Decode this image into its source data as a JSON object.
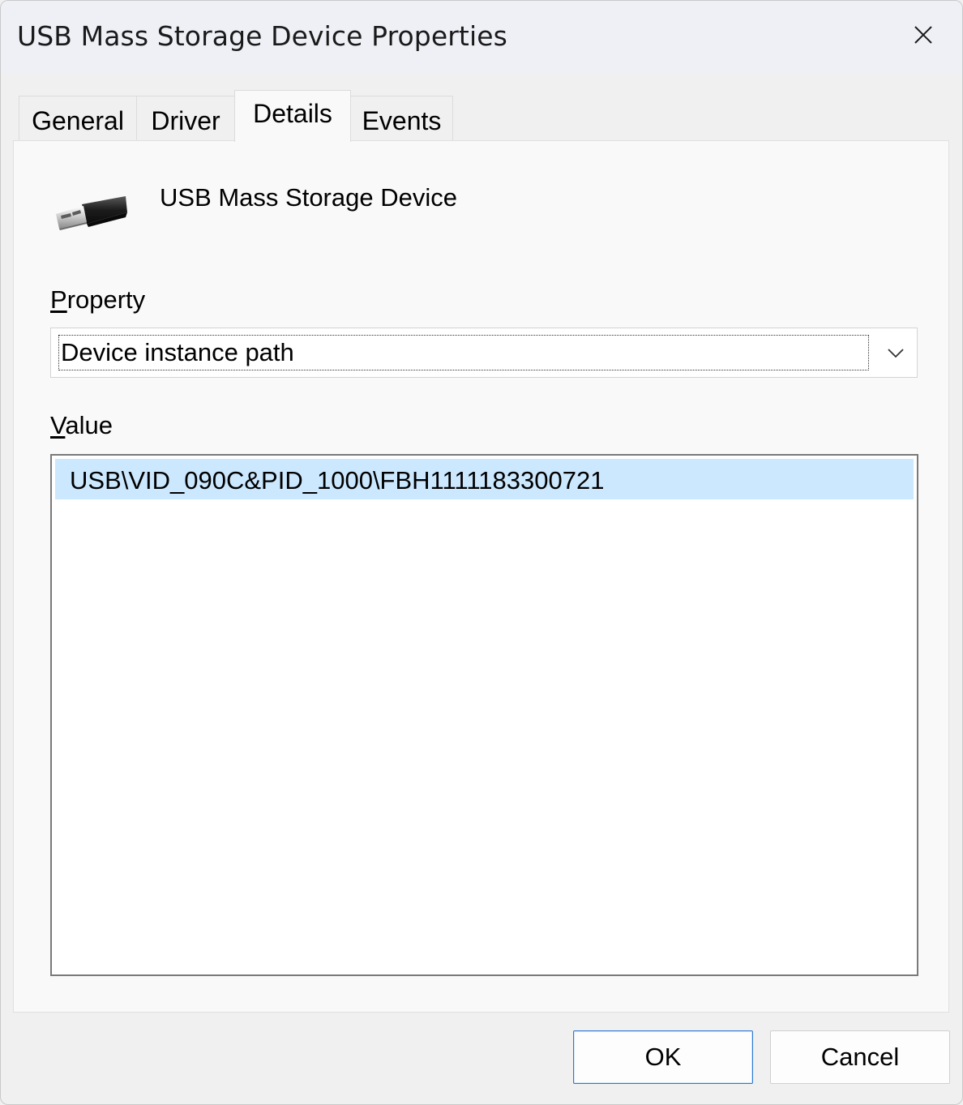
{
  "window": {
    "title": "USB Mass Storage Device Properties"
  },
  "tabs": [
    {
      "label": "General",
      "active": false
    },
    {
      "label": "Driver",
      "active": false
    },
    {
      "label": "Details",
      "active": true
    },
    {
      "label": "Events",
      "active": false
    }
  ],
  "details": {
    "device_icon": "usb-plug-icon",
    "device_name": "USB Mass Storage Device",
    "property_label_accel": "P",
    "property_label_rest": "roperty",
    "property_selected": "Device instance path",
    "value_label_accel": "V",
    "value_label_rest": "alue",
    "values": [
      "USB\\VID_090C&PID_1000\\FBH1111183300721"
    ]
  },
  "buttons": {
    "ok": "OK",
    "cancel": "Cancel"
  },
  "colors": {
    "selection": "#cce8ff",
    "default_button_border": "#2f7ad1"
  }
}
